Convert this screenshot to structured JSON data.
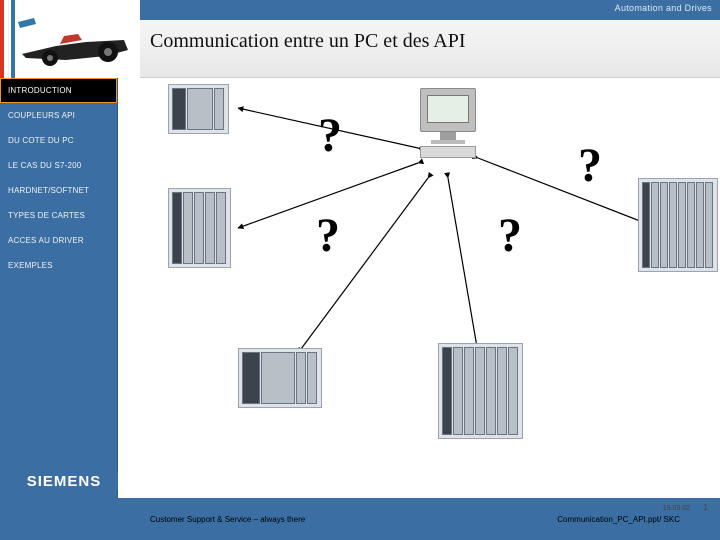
{
  "header": {
    "category": "Automation and Drives"
  },
  "title": "Communication entre un PC et des API",
  "sidebar": {
    "items": [
      {
        "label": "INTRODUCTION",
        "active": true
      },
      {
        "label": "COUPLEURS API"
      },
      {
        "label": "DU COTE DU PC"
      },
      {
        "label": "LE CAS DU S7-200"
      },
      {
        "label": "HARDNET/SOFTNET"
      },
      {
        "label": "TYPES DE CARTES"
      },
      {
        "label": "ACCES AU DRIVER"
      },
      {
        "label": "EXEMPLES"
      }
    ]
  },
  "diagram": {
    "q1": "?",
    "q2": "?",
    "q3": "?",
    "q4": "?",
    "nodes": {
      "central": "pc-workstation",
      "top_left": "plc-compact",
      "mid_left": "plc-modular-small",
      "bottom_left": "plc-compact-200",
      "bottom_center": "plc-modular",
      "right": "plc-rack-large"
    }
  },
  "footer": {
    "brand": "SIEMENS",
    "left": "Customer Support & Service – always there",
    "right": "Communication_PC_API.ppt/ SKC",
    "date": "15.03.02",
    "page": "1"
  }
}
